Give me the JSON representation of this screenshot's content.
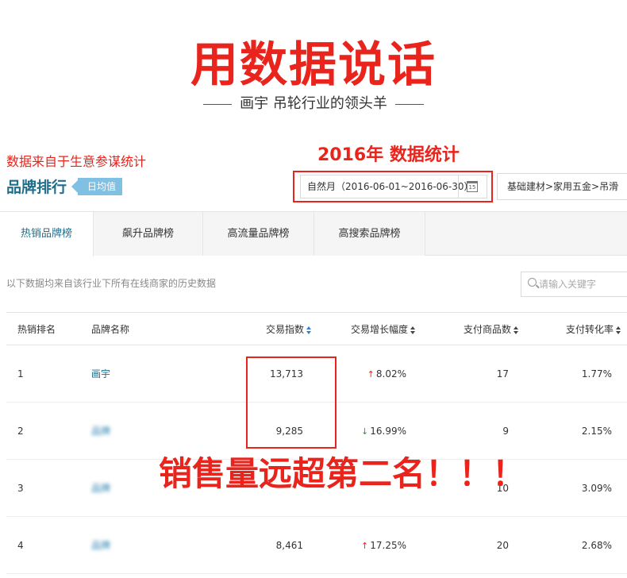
{
  "banner": {
    "headline": "用数据说话",
    "subline": "画宇 吊轮行业的领头羊"
  },
  "annotations": {
    "source_note": "数据来自于生意参谋统计",
    "year_note": "2016年 数据统计",
    "overlay": "销售量远超第二名！！！"
  },
  "header": {
    "title": "品牌排行",
    "tag": "日均值",
    "date_range": "自然月（2016-06-01~2016-06-30）",
    "calendar_day": "15",
    "category": "基础建材>家用五金>吊滑"
  },
  "tabs": [
    {
      "label": "热销品牌榜",
      "active": true
    },
    {
      "label": "飙升品牌榜",
      "active": false
    },
    {
      "label": "高流量品牌榜",
      "active": false
    },
    {
      "label": "高搜索品牌榜",
      "active": false
    }
  ],
  "note": "以下数据均来自该行业下所有在线商家的历史数据",
  "search": {
    "placeholder": "请输入关键字"
  },
  "table": {
    "columns": [
      "热销排名",
      "品牌名称",
      "交易指数",
      "交易增长幅度",
      "支付商品数",
      "支付转化率"
    ],
    "rows": [
      {
        "rank": "1",
        "brand": "画宇",
        "index": "13,713",
        "growth": "8.02%",
        "trend": "up",
        "items": "17",
        "conversion": "1.77%"
      },
      {
        "rank": "2",
        "brand": "品牌",
        "index": "9,285",
        "growth": "16.99%",
        "trend": "down",
        "items": "9",
        "conversion": "2.15%"
      },
      {
        "rank": "3",
        "brand": "品牌",
        "index": "",
        "growth": "",
        "trend": "down",
        "items": "10",
        "conversion": "3.09%"
      },
      {
        "rank": "4",
        "brand": "品牌",
        "index": "8,461",
        "growth": "17.25%",
        "trend": "up",
        "items": "20",
        "conversion": "2.68%"
      }
    ]
  },
  "colors": {
    "accent_red": "#e8241c",
    "brand_blue": "#1f6e8c",
    "tag_blue": "#7fc0e3"
  }
}
